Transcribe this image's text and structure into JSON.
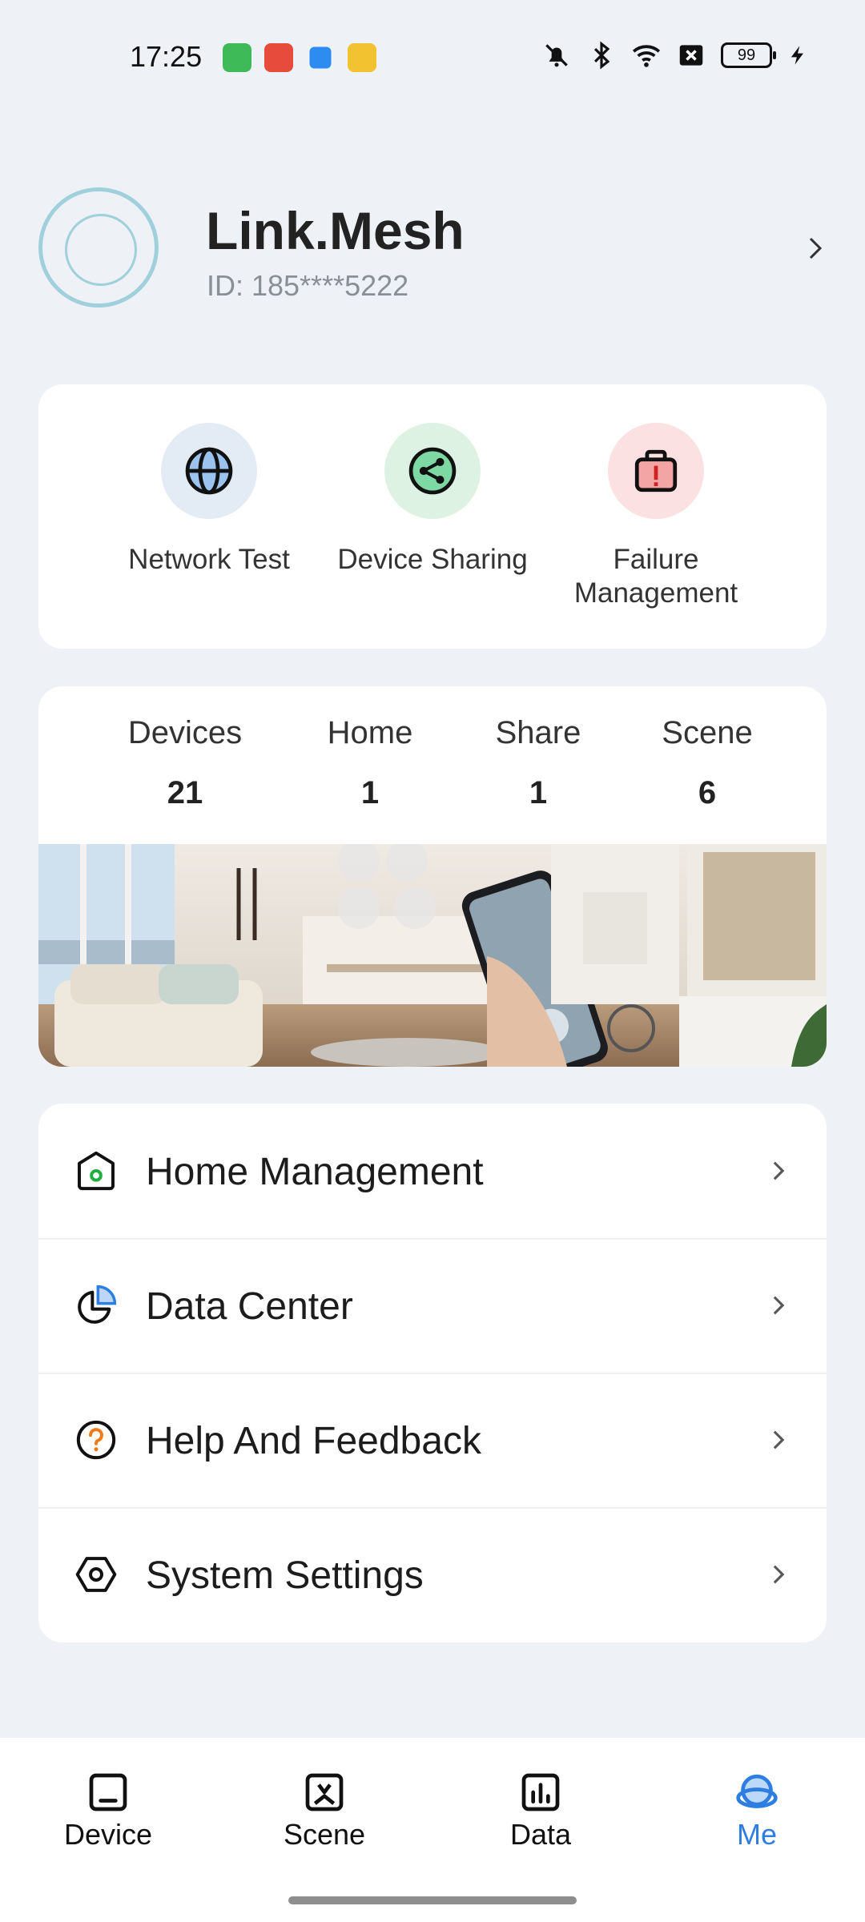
{
  "status_bar": {
    "time": "17:25",
    "battery": "99",
    "app_icons": [
      {
        "name": "green-app-icon",
        "color": "#3fba58"
      },
      {
        "name": "red-music-app-icon",
        "color": "#e64b3c"
      },
      {
        "name": "blue-app-icon",
        "color": "#2d8cf0"
      },
      {
        "name": "yellow-book-app-icon",
        "color": "#f2c230"
      }
    ],
    "icons": [
      "mute-icon",
      "bluetooth-icon",
      "wifi-icon",
      "sim-off-icon",
      "battery-icon",
      "charging-icon"
    ]
  },
  "profile": {
    "name": "Link.Mesh",
    "id_text": "ID: 185****5222"
  },
  "quick_actions": [
    {
      "label": "Network Test",
      "icon": "globe-icon",
      "bg": "#e3ebf5"
    },
    {
      "label": "Device Sharing",
      "icon": "share-icon",
      "bg": "#def2e4"
    },
    {
      "label": "Failure\nManagement",
      "icon": "toolbox-icon",
      "bg": "#fbe1e1"
    }
  ],
  "stats": [
    {
      "label": "Devices",
      "value": "21"
    },
    {
      "label": "Home",
      "value": "1"
    },
    {
      "label": "Share",
      "value": "1"
    },
    {
      "label": "Scene",
      "value": "6"
    }
  ],
  "menu": [
    {
      "label": "Home Management",
      "icon": "home-icon"
    },
    {
      "label": "Data Center",
      "icon": "pie-chart-icon"
    },
    {
      "label": "Help And Feedback",
      "icon": "question-icon"
    },
    {
      "label": "System Settings",
      "icon": "settings-icon"
    }
  ],
  "nav": [
    {
      "label": "Device",
      "icon": "device-icon",
      "active": false
    },
    {
      "label": "Scene",
      "icon": "scene-icon",
      "active": false
    },
    {
      "label": "Data",
      "icon": "data-icon",
      "active": false
    },
    {
      "label": "Me",
      "icon": "me-icon",
      "active": true
    }
  ],
  "colors": {
    "background": "#eef1f6",
    "card": "#ffffff",
    "accent_blue": "#2e7de1",
    "green": "#1fae3f",
    "orange": "#f07a1a"
  }
}
